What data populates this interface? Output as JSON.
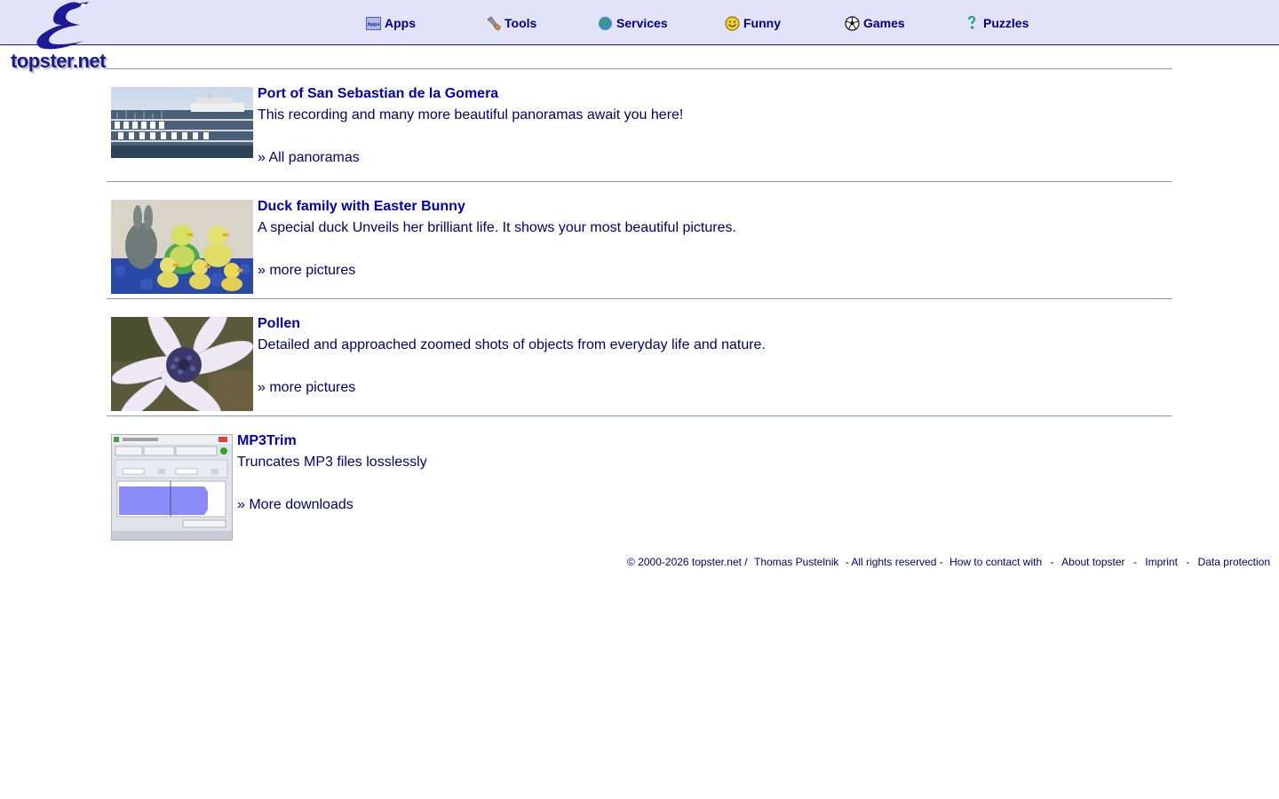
{
  "brand": {
    "logo_text": "topster.net"
  },
  "nav": [
    {
      "label": "Apps",
      "icon": "apps-icon"
    },
    {
      "label": "Tools",
      "icon": "wrench-icon"
    },
    {
      "label": "Services",
      "icon": "globe-icon"
    },
    {
      "label": "Funny",
      "icon": "smiley-icon"
    },
    {
      "label": "Games",
      "icon": "soccer-ball-icon"
    },
    {
      "label": "Puzzles",
      "icon": "puzzle-icon"
    }
  ],
  "entries": [
    {
      "title": "Port of San Sebastian de la Gomera",
      "description": "This recording and many more beautiful panoramas await you here!",
      "link": "» All panoramas",
      "image": "harbor-panorama-image"
    },
    {
      "title": "Duck family with Easter Bunny",
      "description": "A special duck Unveils her brilliant life. It shows your most beautiful pictures.",
      "link": "» more pictures",
      "image": "ducks-bunny-image"
    },
    {
      "title": "Pollen",
      "description": "Detailed and approached zoomed shots of objects from everyday life and nature.",
      "link": "» more pictures",
      "image": "flower-macro-image"
    },
    {
      "title": "MP3Trim",
      "description": "Truncates MP3 files losslessly",
      "link": "» More downloads",
      "image": "mp3trim-screenshot-image"
    }
  ],
  "footer": {
    "copyright": "© 2000-2026 topster.net /",
    "author": "Thomas Pustelnik",
    "rights": "- All rights reserved -",
    "contact": "How to contact with",
    "about": "About topster",
    "imprint": "Imprint",
    "privacy": "Data protection",
    "dash": "-"
  },
  "colors": {
    "header_bg": "#e2e2f8",
    "link": "#0000b4",
    "text": "#00007a",
    "divider": "#8a94b8"
  }
}
